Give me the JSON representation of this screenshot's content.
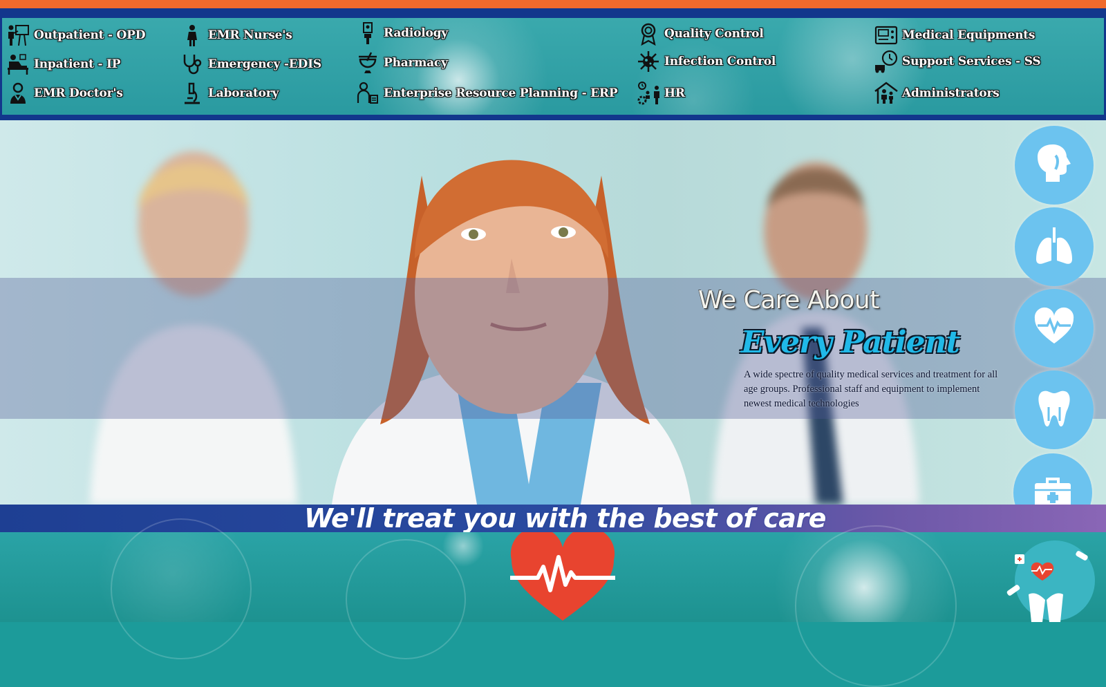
{
  "colors": {
    "accent_orange": "#f06a2c",
    "navy": "#12378c",
    "teal": "#2a9aa0",
    "circle_button": "#6cc3ef",
    "heart_red": "#e8442f"
  },
  "modules": [
    {
      "label": "Outpatient - OPD",
      "icon": "outpatient-icon"
    },
    {
      "label": "Inpatient - IP",
      "icon": "inpatient-bed-icon"
    },
    {
      "label": "EMR Doctor's",
      "icon": "doctor-icon"
    },
    {
      "label": "EMR Nurse's",
      "icon": "nurse-icon"
    },
    {
      "label": "Emergency -EDIS",
      "icon": "stethoscope-icon"
    },
    {
      "label": "Laboratory",
      "icon": "microscope-icon"
    },
    {
      "label": "Radiology",
      "icon": "xray-icon"
    },
    {
      "label": "Pharmacy",
      "icon": "mortar-pestle-icon"
    },
    {
      "label": "Enterprise Resource Planning - ERP",
      "icon": "erp-person-icon"
    },
    {
      "label": "Quality Control",
      "icon": "award-ribbon-icon"
    },
    {
      "label": "Infection Control",
      "icon": "virus-icon"
    },
    {
      "label": "HR",
      "icon": "hr-people-gear-icon"
    },
    {
      "label": "Medical Equipments",
      "icon": "medical-device-icon"
    },
    {
      "label": "Support Services - SS",
      "icon": "truck-clock-icon"
    },
    {
      "label": "Administrators",
      "icon": "house-family-icon"
    }
  ],
  "hero": {
    "heading": "We Care About",
    "subheading": "Every Patient",
    "description": "A wide spectre of quality medical services and treatment for all age groups. Professional staff and equipment to implement newest medical technologies"
  },
  "side_buttons": [
    {
      "icon": "throat-head-icon"
    },
    {
      "icon": "lungs-icon"
    },
    {
      "icon": "heart-pulse-icon"
    },
    {
      "icon": "tooth-icon"
    },
    {
      "icon": "first-aid-kit-icon"
    }
  ],
  "tagline": "We'll treat you with the best of care"
}
